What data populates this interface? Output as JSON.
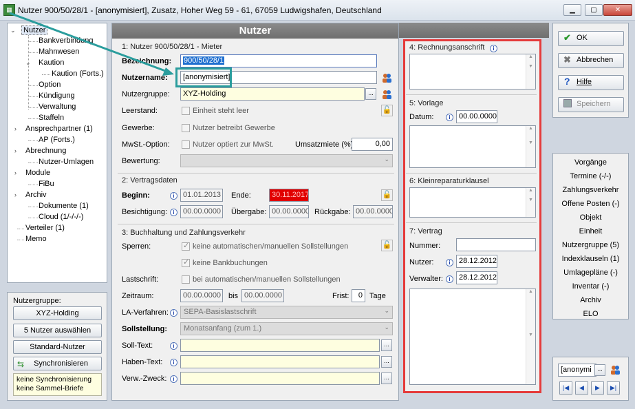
{
  "window": {
    "title": "Nutzer 900/50/28/1 - [anonymisiert], Zusatz, Hoher Weg 59 - 61, 67059 Ludwigshafen, Deutschland"
  },
  "tree": {
    "items": [
      {
        "label": "Nutzer"
      },
      {
        "label": "Bankverbindung"
      },
      {
        "label": "Mahnwesen"
      },
      {
        "label": "Kaution"
      },
      {
        "label": "Kaution (Forts.)"
      },
      {
        "label": "Option"
      },
      {
        "label": "Kündigung"
      },
      {
        "label": "Verwaltung"
      },
      {
        "label": "Staffeln"
      },
      {
        "label": "Ansprechpartner (1)"
      },
      {
        "label": "AP (Forts.)"
      },
      {
        "label": "Abrechnung"
      },
      {
        "label": "Nutzer-Umlagen"
      },
      {
        "label": "Module"
      },
      {
        "label": "FiBu"
      },
      {
        "label": "Archiv"
      },
      {
        "label": "Dokumente (1)"
      },
      {
        "label": "Cloud (1/-/-/-)"
      },
      {
        "label": "Verteiler (1)"
      },
      {
        "label": "Memo"
      }
    ]
  },
  "group": {
    "title": "Nutzergruppe:",
    "btn_group": "XYZ-Holding",
    "btn_select": "5 Nutzer auswählen",
    "btn_standard": "Standard-Nutzer",
    "btn_sync": "Synchronisieren",
    "note": "keine Synchronisierung\nkeine Sammel-Briefe"
  },
  "main": {
    "header": "Nutzer",
    "s1": {
      "title": "1: Nutzer 900/50/28/1 - Mieter",
      "bez_label": "Bezeichnung:",
      "bez_value": "900/50/28/1",
      "name_label": "Nutzername:",
      "name_value": "[anonymisiert]",
      "gruppe_label": "Nutzergruppe:",
      "gruppe_value": "XYZ-Holding",
      "leer_label": "Leerstand:",
      "leer_check": "Einheit steht leer",
      "gew_label": "Gewerbe:",
      "gew_check": "Nutzer betreibt Gewerbe",
      "mwst_label": "MwSt.-Option:",
      "mwst_check": "Nutzer optiert zur MwSt.",
      "umsatz_label": "Umsatzmiete (%):",
      "umsatz_value": "0,00",
      "bew_label": "Bewertung:"
    },
    "s2": {
      "title": "2: Vertragsdaten",
      "beginn_label": "Beginn:",
      "beginn_value": "01.01.2013",
      "ende_label": "Ende:",
      "ende_value": "30.11.2017",
      "besicht_label": "Besichtigung:",
      "besicht_value": "00.00.0000",
      "uebergabe_label": "Übergabe:",
      "uebergabe_value": "00.00.0000",
      "rueck_label": "Rückgabe:",
      "rueck_value": "00.00.0000"
    },
    "s3": {
      "title": "3: Buchhaltung und Zahlungsverkehr",
      "sperren_label": "Sperren:",
      "sperren_check1": "keine automatischen/manuellen Sollstellungen",
      "sperren_check2": "keine Bankbuchungen",
      "last_label": "Lastschrift:",
      "last_check": "bei automatischen/manuellen Sollstellungen",
      "zeit_label": "Zeitraum:",
      "zeit_from": "00.00.0000",
      "bis": "bis",
      "zeit_to": "00.00.0000",
      "frist_label": "Frist:",
      "frist_value": "0",
      "tage": "Tage",
      "la_label": "LA-Verfahren:",
      "la_value": "SEPA-Basislastschrift",
      "soll_label": "Sollstellung:",
      "soll_value": "Monatsanfang (zum 1.)",
      "solltext_label": "Soll-Text:",
      "habentext_label": "Haben-Text:",
      "verw_label": "Verw.-Zweck:"
    }
  },
  "right": {
    "s4": {
      "title": "4: Rechnungsanschrift"
    },
    "s5": {
      "title": "5: Vorlage",
      "datum_label": "Datum:",
      "datum_value": "00.00.0000"
    },
    "s6": {
      "title": "6: Kleinreparaturklausel"
    },
    "s7": {
      "title": "7: Vertrag",
      "nummer_label": "Nummer:",
      "nummer_value": "",
      "nutzer_label": "Nutzer:",
      "nutzer_value": "28.12.2012",
      "verwalter_label": "Verwalter:",
      "verwalter_value": "28.12.2012"
    }
  },
  "actions": {
    "ok": "OK",
    "cancel": "Abbrechen",
    "help": "Hilfe",
    "save": "Speichern"
  },
  "links": [
    "Vorgänge",
    "Termine (-/-)",
    "Zahlungsverkehr",
    "Offene Posten (-)",
    "Objekt",
    "Einheit",
    "Nutzergruppe (5)",
    "Indexklauseln (1)",
    "Umlagepläne (-)",
    "Inventar (-)",
    "Archiv",
    "ELO"
  ],
  "nav": {
    "field": "[anonymi"
  },
  "colors": {
    "highlight_box": "#2a9d9d",
    "red_box": "#e53a3a",
    "end_date_bg": "#e10000"
  }
}
